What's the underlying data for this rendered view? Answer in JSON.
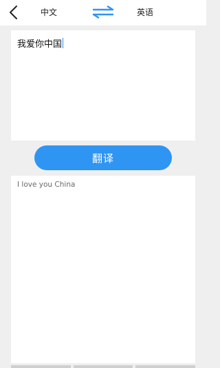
{
  "header": {
    "source_language": "中文",
    "target_language": "英语"
  },
  "icons": {
    "back": "chevron-left-icon",
    "swap": "swap-arrows-icon"
  },
  "colors": {
    "accent": "#2f95f3",
    "background": "#efefef",
    "panel": "#ffffff"
  },
  "input": {
    "value": "我爱你中国"
  },
  "actions": {
    "translate_label": "翻译"
  },
  "output": {
    "value": "I love you China"
  }
}
